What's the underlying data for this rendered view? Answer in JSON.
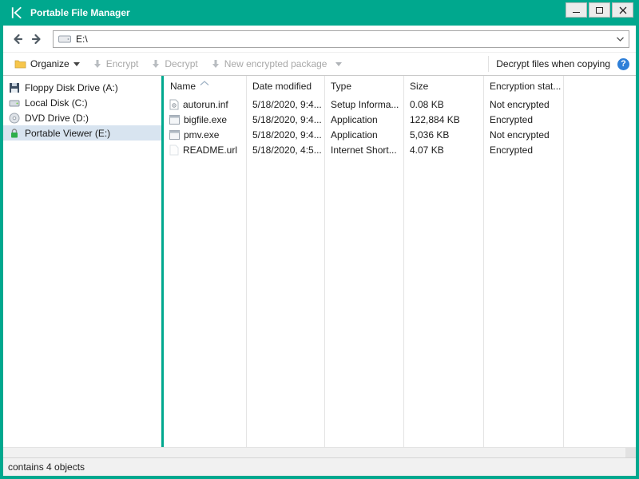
{
  "window": {
    "title": "Portable File Manager"
  },
  "navbar": {
    "address": "E:\\"
  },
  "toolbar": {
    "organize_label": "Organize",
    "encrypt_label": "Encrypt",
    "decrypt_label": "Decrypt",
    "new_package_label": "New encrypted package",
    "decrypt_when_copying_label": "Decrypt files when copying",
    "help_glyph": "?"
  },
  "sidebar": {
    "items": [
      {
        "label": "Floppy Disk Drive (A:)",
        "icon": "floppy-disk-icon",
        "selected": false
      },
      {
        "label": "Local Disk (C:)",
        "icon": "hard-disk-icon",
        "selected": false
      },
      {
        "label": "DVD Drive (D:)",
        "icon": "dvd-disc-icon",
        "selected": false
      },
      {
        "label": "Portable Viewer (E:)",
        "icon": "encrypted-drive-lock-icon",
        "selected": true
      }
    ]
  },
  "filelist": {
    "columns": [
      "Name",
      "Date modified",
      "Type",
      "Size",
      "Encryption stat..."
    ],
    "rows": [
      {
        "icon": "setup-information-file-icon",
        "name": "autorun.inf",
        "date": "5/18/2020, 9:4...",
        "type": "Setup Informa...",
        "size": "0.08 KB",
        "encryption": "Not encrypted"
      },
      {
        "icon": "application-file-icon",
        "name": "bigfile.exe",
        "date": "5/18/2020, 9:4...",
        "type": "Application",
        "size": "122,884 KB",
        "encryption": "Encrypted"
      },
      {
        "icon": "application-file-icon",
        "name": "pmv.exe",
        "date": "5/18/2020, 9:4...",
        "type": "Application",
        "size": "5,036 KB",
        "encryption": "Not encrypted"
      },
      {
        "icon": "internet-shortcut-file-icon",
        "name": "README.url",
        "date": "5/18/2020, 4:5...",
        "type": "Internet Short...",
        "size": "4.07 KB",
        "encryption": "Encrypted"
      }
    ]
  },
  "statusbar": {
    "text": "contains 4 objects"
  },
  "colors": {
    "brand_green": "#00a88e",
    "selection_highlight": "#d8e4f0",
    "help_blue": "#2e7fd8",
    "disabled_text": "#a8a8a8"
  }
}
